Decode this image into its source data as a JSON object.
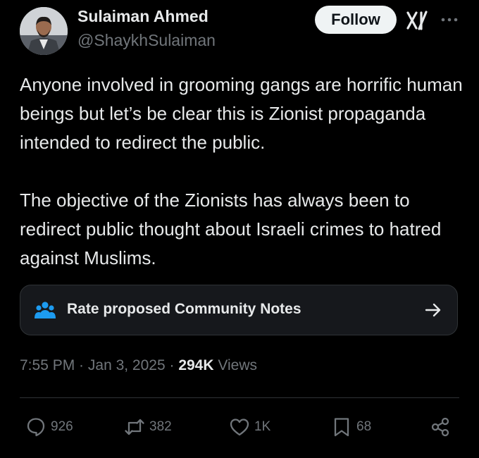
{
  "author": {
    "name": "Sulaiman Ahmed",
    "handle": "@ShaykhSulaiman"
  },
  "header": {
    "follow_label": "Follow",
    "icons": [
      "grok-icon",
      "more-icon"
    ]
  },
  "tweet": {
    "paragraphs": [
      "Anyone involved in grooming gangs are horrific human beings but let’s be clear this is Zionist propaganda intended to redirect the public.",
      "The objective of the Zionists has always been to redirect public thought about Israeli crimes to hatred against Muslims."
    ]
  },
  "community_notes": {
    "label": "Rate proposed Community Notes",
    "icon": "people-icon",
    "accent": "#1d9bf0"
  },
  "meta": {
    "time": "7:55 PM",
    "separator": " · ",
    "date": "Jan 3, 2025",
    "views_count": "294K",
    "views_label": "Views"
  },
  "actions": {
    "replies": "926",
    "reposts": "382",
    "likes": "1K",
    "bookmarks": "68"
  },
  "colors": {
    "background": "#000000",
    "text": "#e7e9ea",
    "secondary": "#71767b",
    "border": "#2f3336"
  }
}
